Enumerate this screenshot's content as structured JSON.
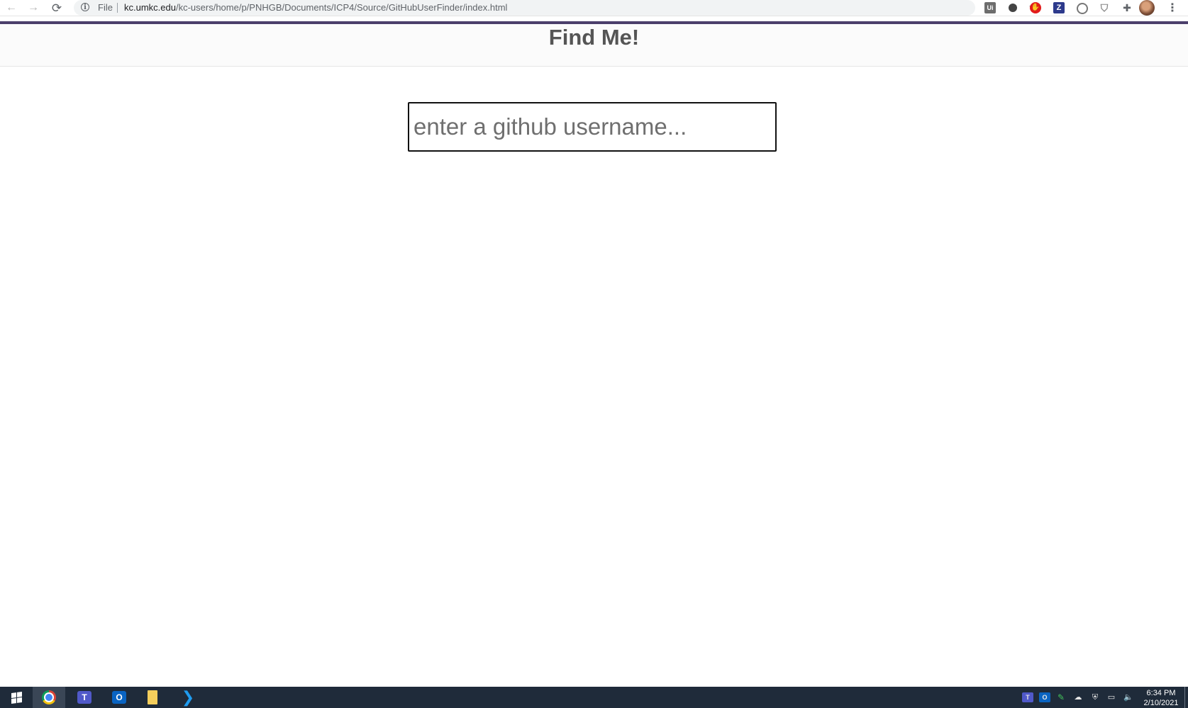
{
  "browser": {
    "back_glyph": "←",
    "forward_glyph": "→",
    "reload_glyph": "⟳",
    "info_glyph": "i",
    "scheme_label": "File",
    "url_host": "kc.umkc.edu",
    "url_path": "/kc-users/home/p/PNHGB/Documents/ICP4/Source/GitHubUserFinder/index.html",
    "star_glyph": "☆",
    "extensions": [
      {
        "name": "ui-extension-icon",
        "glyph": "Ui"
      },
      {
        "name": "circle-extension-icon",
        "glyph": ""
      },
      {
        "name": "stop-extension-icon",
        "glyph": "✋"
      },
      {
        "name": "z-extension-icon",
        "glyph": "Z"
      },
      {
        "name": "ring-extension-icon",
        "glyph": "( )"
      },
      {
        "name": "shield-extension-icon",
        "glyph": "⛉"
      },
      {
        "name": "puzzle-extensions-icon",
        "glyph": "✚"
      }
    ],
    "menu_glyph": "⋮"
  },
  "page": {
    "title": "Find Me!",
    "search_placeholder": "enter a github username...",
    "search_value": "",
    "accent_color": "#4b3f6b"
  },
  "taskbar": {
    "apps": [
      "start",
      "chrome",
      "teams",
      "outlook",
      "file-explorer",
      "vscode"
    ],
    "teams_letter": "T",
    "outlook_letter": "O",
    "tray": {
      "teams_letter": "T",
      "outlook_letter": "O",
      "green_glyph": "✎",
      "cloud_glyph": "☁",
      "security_glyph": "⛨",
      "network_glyph": "▭",
      "volume_glyph": "🔈"
    },
    "time": "6:34 PM",
    "date": "2/10/2021"
  }
}
